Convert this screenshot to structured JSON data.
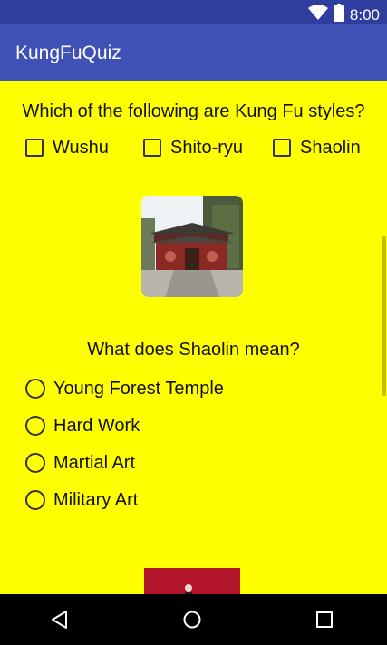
{
  "status_bar": {
    "time": "8:00",
    "icons": [
      "wifi-icon",
      "battery-icon"
    ]
  },
  "app_bar": {
    "title": "KungFuQuiz"
  },
  "colors": {
    "status_bar": "#303f9f",
    "app_bar": "#3f51b5",
    "background": "#ffff00"
  },
  "question1": {
    "text": "Which of the following are Kung Fu styles?",
    "options": [
      {
        "label": "Wushu",
        "checked": false
      },
      {
        "label": "Shito-ryu",
        "checked": false
      },
      {
        "label": "Shaolin",
        "checked": false
      }
    ]
  },
  "question2": {
    "text": "What does Shaolin mean?",
    "options": [
      {
        "label": "Young Forest Temple",
        "selected": false
      },
      {
        "label": "Hard Work",
        "selected": false
      },
      {
        "label": "Martial Art",
        "selected": false
      },
      {
        "label": "Military Art",
        "selected": false
      }
    ]
  },
  "nav_bar": {
    "icons": [
      "back-icon",
      "home-icon",
      "recents-icon"
    ]
  }
}
